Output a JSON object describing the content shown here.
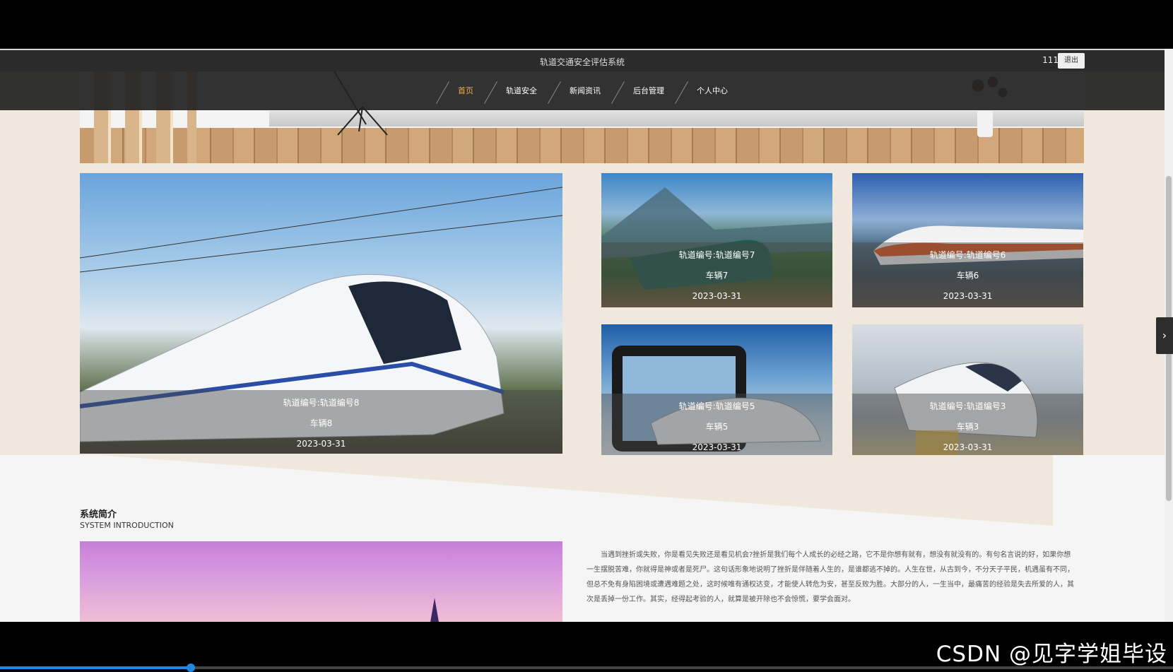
{
  "header": {
    "site_title": "轨道交通安全评估系统",
    "username": "111",
    "logout_label": "退出"
  },
  "nav": {
    "items": [
      {
        "label": "首页",
        "active": true
      },
      {
        "label": "轨道安全",
        "active": false
      },
      {
        "label": "新闻资讯",
        "active": false
      },
      {
        "label": "后台管理",
        "active": false
      },
      {
        "label": "个人中心",
        "active": false
      }
    ]
  },
  "cards": [
    {
      "track": "轨道编号:轨道编号8",
      "vehicle": "车辆8",
      "date": "2023-03-31"
    },
    {
      "track": "轨道编号:轨道编号7",
      "vehicle": "车辆7",
      "date": "2023-03-31"
    },
    {
      "track": "轨道编号:轨道编号6",
      "vehicle": "车辆6",
      "date": "2023-03-31"
    },
    {
      "track": "轨道编号:轨道编号5",
      "vehicle": "车辆5",
      "date": "2023-03-31"
    },
    {
      "track": "轨道编号:轨道编号3",
      "vehicle": "车辆3",
      "date": "2023-03-31"
    }
  ],
  "intro": {
    "title": "系统简介",
    "subtitle": "SYSTEM INTRODUCTION",
    "text": "当遇到挫折或失败，你是看见失败还是看见机会?挫折是我们每个人成长的必经之路，它不是你想有就有，想没有就没有的。有句名言说的好，如果你想一生摆脱苦难，你就得是神或者是死尸。这句话形象地说明了挫折是伴随着人生的，是谁都逃不掉的。人生在世，从古到今，不分天子平民，机遇虽有不同，但总不免有身陷困境或遭遇难题之处，这时候唯有通权达变，才能使人转危为安，甚至反败为胜。大部分的人，一生当中，最痛苦的经验是失去所爱的人，其次是丢掉一份工作。其实，经得起考验的人，就算是被开除也不会惊慌，要学会面对。"
  },
  "watermark": "CSDN @见字学姐毕设",
  "colors": {
    "accent": "#e8b04a",
    "nav_bg": "#222222",
    "page_bg": "#f0e8dd"
  }
}
